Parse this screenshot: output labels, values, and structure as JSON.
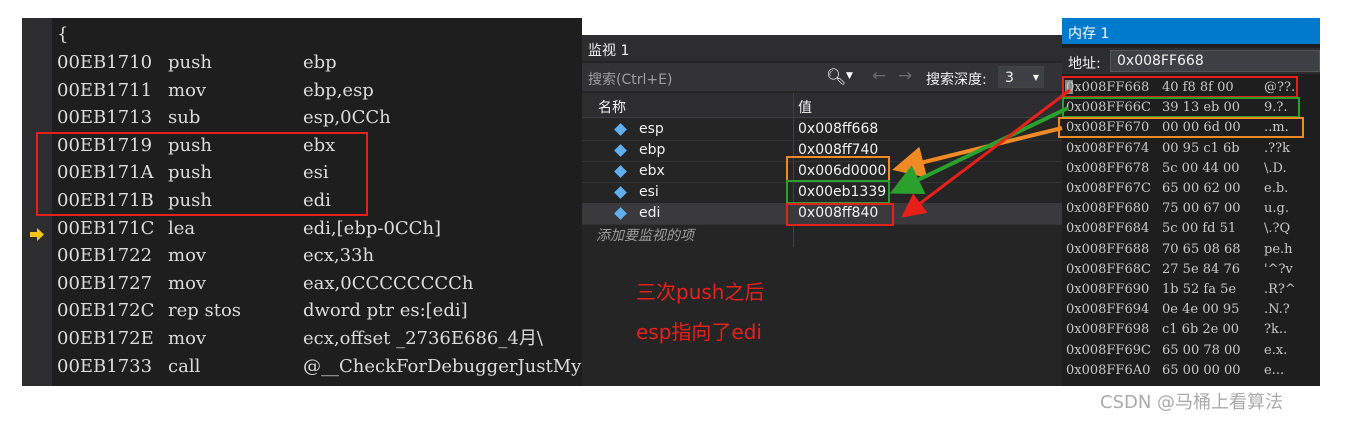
{
  "disassembly": {
    "brace": "{",
    "lines": [
      {
        "addr": "00EB1710",
        "op": "push",
        "args": "ebp"
      },
      {
        "addr": "00EB1711",
        "op": "mov",
        "args": "ebp,esp"
      },
      {
        "addr": "00EB1713",
        "op": "sub",
        "args": "esp,0CCh"
      },
      {
        "addr": "00EB1719",
        "op": "push",
        "args": "ebx"
      },
      {
        "addr": "00EB171A",
        "op": "push",
        "args": "esi"
      },
      {
        "addr": "00EB171B",
        "op": "push",
        "args": "edi"
      },
      {
        "addr": "00EB171C",
        "op": "lea",
        "args": "edi,[ebp-0CCh]"
      },
      {
        "addr": "00EB1722",
        "op": "mov",
        "args": "ecx,33h"
      },
      {
        "addr": "00EB1727",
        "op": "mov",
        "args": "eax,0CCCCCCCCh"
      },
      {
        "addr": "00EB172C",
        "op": "rep stos",
        "args": "dword ptr es:[edi]"
      },
      {
        "addr": "00EB172E",
        "op": "mov",
        "args": "ecx,offset _2736E686_4月\\"
      },
      {
        "addr": "00EB1733",
        "op": "call",
        "args": "@__CheckForDebuggerJustMy"
      }
    ],
    "current_line_icon": "current-instruction-arrow-icon"
  },
  "watch": {
    "title": "监视 1",
    "search_placeholder": "搜索(Ctrl+E)",
    "search_icon": "search-icon",
    "depth_label": "搜索深度:",
    "depth_value": "3",
    "col_name": "名称",
    "col_value": "值",
    "rows": [
      {
        "name": "esp",
        "value": "0x008ff668"
      },
      {
        "name": "ebp",
        "value": "0x008ff740"
      },
      {
        "name": "ebx",
        "value": "0x006d0000"
      },
      {
        "name": "esi",
        "value": "0x00eb1339"
      },
      {
        "name": "edi",
        "value": "0x008ff840"
      }
    ],
    "add_watch": "添加要监视的项"
  },
  "memory": {
    "title": "内存 1",
    "address_label": "地址:",
    "address_value": "0x008FF668",
    "rows": [
      {
        "addr": "0x008FF668",
        "bytes": "40 f8 8f 00",
        "ascii": "@??."
      },
      {
        "addr": "0x008FF66C",
        "bytes": "39 13 eb 00",
        "ascii": "9.?."
      },
      {
        "addr": "0x008FF670",
        "bytes": "00 00 6d 00",
        "ascii": "..m."
      },
      {
        "addr": "0x008FF674",
        "bytes": "00 95 c1 6b",
        "ascii": ".??k"
      },
      {
        "addr": "0x008FF678",
        "bytes": "5c 00 44 00",
        "ascii": "\\.D."
      },
      {
        "addr": "0x008FF67C",
        "bytes": "65 00 62 00",
        "ascii": "e.b."
      },
      {
        "addr": "0x008FF680",
        "bytes": "75 00 67 00",
        "ascii": "u.g."
      },
      {
        "addr": "0x008FF684",
        "bytes": "5c 00 fd 51",
        "ascii": "\\.?Q"
      },
      {
        "addr": "0x008FF688",
        "bytes": "70 65 08 68",
        "ascii": "pe.h"
      },
      {
        "addr": "0x008FF68C",
        "bytes": "27 5e 84 76",
        "ascii": "'^?v"
      },
      {
        "addr": "0x008FF690",
        "bytes": "1b 52 fa 5e",
        "ascii": ".R?^"
      },
      {
        "addr": "0x008FF694",
        "bytes": "0e 4e 00 95",
        "ascii": ".N.?"
      },
      {
        "addr": "0x008FF698",
        "bytes": "c1 6b 2e 00",
        "ascii": "?k.."
      },
      {
        "addr": "0x008FF69C",
        "bytes": "65 00 78 00",
        "ascii": "e.x."
      },
      {
        "addr": "0x008FF6A0",
        "bytes": "65 00 00 00",
        "ascii": "e..."
      }
    ]
  },
  "annotation": {
    "line1": "三次push之后",
    "line2": "esp指向了edi"
  },
  "watermark": "CSDN @马桶上看算法",
  "colors": {
    "red": "#e8201a",
    "green": "#2ca02c",
    "orange": "#f08a24"
  }
}
